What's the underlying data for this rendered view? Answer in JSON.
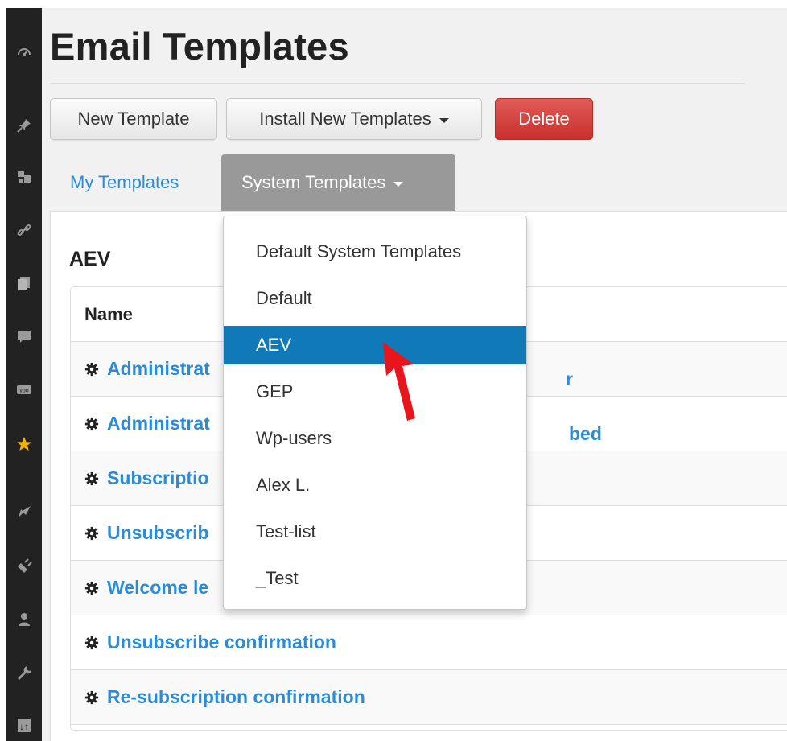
{
  "page": {
    "title": "Email Templates"
  },
  "toolbar": {
    "new_template_label": "New Template",
    "install_templates_label": "Install New Templates",
    "delete_label": "Delete"
  },
  "tabs": {
    "my_templates": "My Templates",
    "system_templates": "System Templates"
  },
  "section": {
    "title": "AEV"
  },
  "table": {
    "header": "Name",
    "rows": [
      "Administrator notification: new subscriber",
      "Administrator notification: user unsubscribed",
      "Subscription confirmation",
      "Unsubscribe notification",
      "Welcome letter",
      "Unsubscribe confirmation",
      "Re-subscription confirmation"
    ],
    "visible_rows": [
      "Administrat",
      "Administrat",
      "Subscriptio",
      "Unsubscrib",
      "Welcome le",
      "Unsubscribe confirmation",
      "Re-subscription confirmation"
    ],
    "right_tails": [
      "r",
      "bed"
    ]
  },
  "dropdown": {
    "items": [
      "Default System Templates",
      "Default",
      "AEV",
      "GEP",
      "Wp-users",
      "Alex L.",
      "Test-list",
      "_Test"
    ],
    "selected": "AEV"
  },
  "sidebar": {
    "icons": [
      "dashboard-icon",
      "pin-icon",
      "media-icon",
      "link-icon",
      "pages-icon",
      "comments-icon",
      "plugin-icon",
      "star-icon",
      "appearance-icon",
      "plugins-icon",
      "users-icon",
      "tools-icon",
      "settings-icon"
    ]
  },
  "colors": {
    "sidebar_bg": "#222222",
    "link_blue": "#2a8bd8",
    "active_item": "#0f7ab7",
    "delete_red": "#d9534f",
    "arrow_red": "#e8151c",
    "tab_gray": "#999999",
    "star_yellow": "#f0b400"
  }
}
